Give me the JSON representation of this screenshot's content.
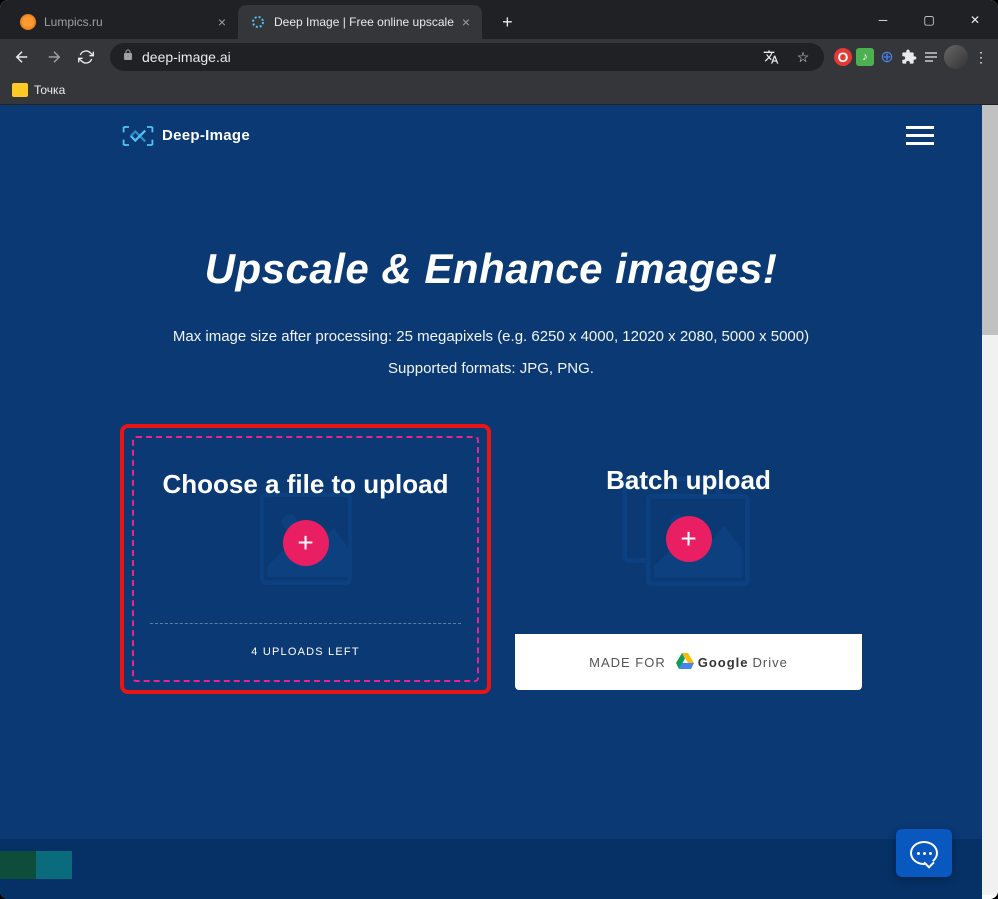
{
  "browser": {
    "tabs": [
      {
        "title": "Lumpics.ru"
      },
      {
        "title": "Deep Image | Free online upscale"
      }
    ],
    "url": "deep-image.ai",
    "bookmark": "Точка"
  },
  "header": {
    "logo_text": "Deep-Image"
  },
  "hero": {
    "title": "Upscale & Enhance images!",
    "sub1": "Max image size after processing: 25 megapixels (e.g. 6250 x 4000, 12020 x 2080, 5000 x 5000)",
    "sub2": "Supported formats: JPG, PNG."
  },
  "upload": {
    "single_title": "Choose a file to upload",
    "uploads_left": "4 UPLOADS LEFT",
    "batch_title": "Batch upload",
    "made_for": "MADE FOR",
    "google": "Google",
    "drive": " Drive"
  }
}
